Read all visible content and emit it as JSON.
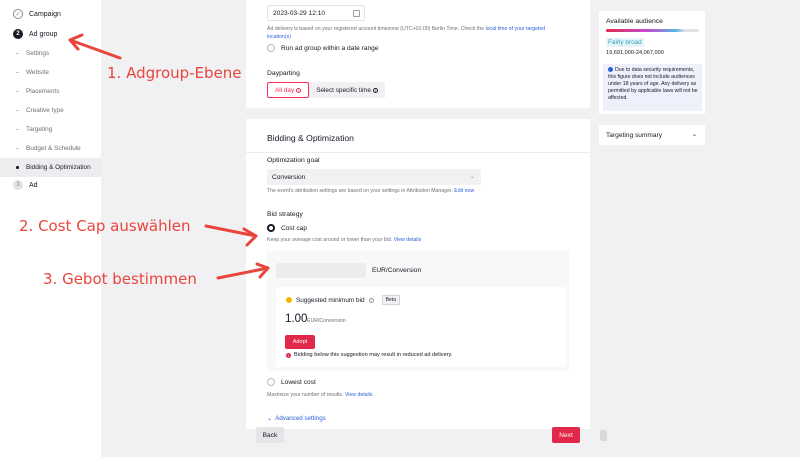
{
  "sidebar": {
    "steps": [
      {
        "label": "Campaign",
        "marker": "check-icon"
      },
      {
        "label": "Ad group",
        "marker": "2"
      },
      {
        "label": "Ad",
        "marker": "3"
      }
    ],
    "sub_items": [
      "Settings",
      "Website",
      "Placements",
      "Creative type",
      "Targeting",
      "Budget & Schedule",
      "Bidding & Optimization"
    ],
    "active_sub_item": "Bidding & Optimization"
  },
  "schedule": {
    "start_datetime": "2023-03-29 12:10",
    "timezone_note": "Ad delivery is based on your registered account timezone (UTC+01:00) Berlin Time. Check the",
    "timezone_link": "local time of your targeted location(s)",
    "date_range_option": "Run ad group within a date range"
  },
  "dayparting": {
    "label": "Dayparting",
    "options": [
      "All day",
      "Select specific time"
    ],
    "selected": "All day"
  },
  "bidding": {
    "section_title": "Bidding & Optimization",
    "optimization_goal_label": "Optimization goal",
    "optimization_goal_value": "Conversion",
    "attribution_note": "The event's attribution settings are based on your settings in Attribution Manager.",
    "attribution_link": "Edit now",
    "bid_strategy_label": "Bid strategy",
    "cost_cap_label": "Cost cap",
    "cost_cap_hint": "Keep your average cost around or lower than your bid.",
    "view_details": "View details",
    "bid_value": "",
    "bid_unit": "EUR/Conversion",
    "suggested_label": "Suggested minimum bid",
    "beta_badge": "Beta",
    "suggested_value": "1.00",
    "suggested_unit": "EUR/Conversion",
    "adopt_label": "Adopt",
    "warning": "Bidding below this suggestion may result in reduced ad delivery.",
    "lowest_cost_label": "Lowest cost",
    "lowest_cost_hint": "Maximize your number of results.",
    "advanced_settings": "Advanced settings"
  },
  "footer": {
    "back_label": "Back",
    "next_label": "Next"
  },
  "audience": {
    "title": "Available audience",
    "badge": "Fairly broad",
    "range": "19,691,000-24,067,000",
    "note": "Due to data security requirements, this figure does not include audiences under 18 years of age. Any delivery as permitted by applicable laws will not be affected."
  },
  "targeting_summary": {
    "title": "Targeting summary"
  },
  "annotations": {
    "step1": "1. Adgroup-Ebene",
    "step2": "2. Cost Cap auswählen",
    "step3": "3. Gebot bestimmen",
    "color": "#e8453c"
  },
  "colors": {
    "accent": "#fe2c55",
    "primary_button": "#e0284a",
    "link": "#2c5fd8"
  }
}
